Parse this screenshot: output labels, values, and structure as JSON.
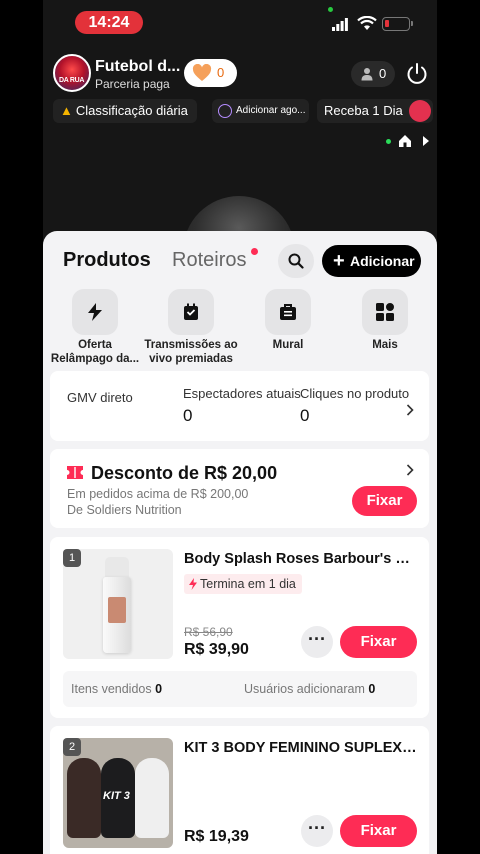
{
  "status_bar": {
    "time": "14:24"
  },
  "stream": {
    "channel_name": "Futebol d...",
    "channel_sub": "Parceria paga",
    "avatar_text": "DA RUA",
    "likes": "0",
    "viewers": "0"
  },
  "chips": {
    "ranking": "Classificação diária",
    "add": "Adicionar ago...",
    "gift": "Receba 1 Dia"
  },
  "sheet": {
    "tabs": {
      "products": "Produtos",
      "scripts": "Roteiros"
    },
    "add_button": "Adicionar",
    "features": [
      {
        "line1": "Oferta",
        "line2": "Relâmpago da...",
        "icon": "lightning-icon"
      },
      {
        "line1": "Transmissões ao",
        "line2": "vivo premiadas",
        "icon": "calendar-gift-icon"
      },
      {
        "line1": "Mural",
        "line2": "",
        "icon": "bag-icon"
      },
      {
        "line1": "Mais",
        "line2": "",
        "icon": "grid-icon"
      }
    ],
    "stats": {
      "gmv_label": "GMV direto",
      "viewers_label": "Espectadores atuais",
      "viewers_value": "0",
      "clicks_label": "Cliques no produto",
      "clicks_value": "0"
    },
    "discount": {
      "title": "Desconto de R$ 20,00",
      "condition": "Em pedidos acima de R$ 200,00",
      "seller": "De Soldiers Nutrition",
      "button": "Fixar"
    },
    "products": [
      {
        "rank": "1",
        "title": "Body Splash Roses Barbour's Be...",
        "tag": "Termina em 1 dia",
        "old_price": "R$ 56,90",
        "price": "R$ 39,90",
        "button": "Fixar",
        "more": "···",
        "sold_label": "Itens vendidos",
        "sold_value": "0",
        "users_label": "Usuários adicionaram",
        "users_value": "0"
      },
      {
        "rank": "2",
        "title": "KIT 3 BODY FEMININO SUPLEX R...",
        "image_text": "KIT 3",
        "price": "R$ 19,39",
        "button": "Fixar",
        "more": "···"
      }
    ]
  },
  "colors": {
    "accent": "#fe2c55",
    "time_pill": "#e3323a",
    "sheet_bg": "#f3f3f5"
  }
}
